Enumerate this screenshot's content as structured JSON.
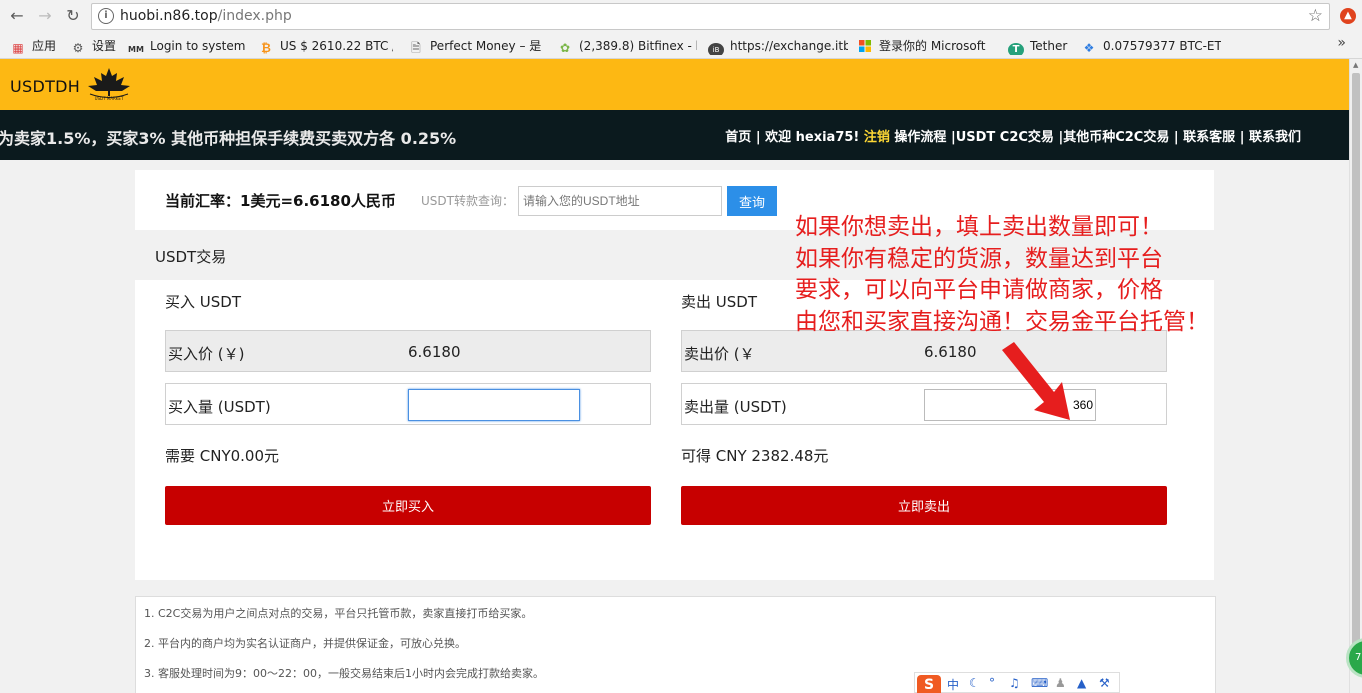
{
  "browser": {
    "url_host": "huobi.n86.top",
    "url_path": "/index.php",
    "bookmarks": [
      {
        "label": "应用",
        "icon": "apps-grid-icon"
      },
      {
        "label": "设置",
        "icon": "gear-icon"
      },
      {
        "label": "Login to system",
        "icon": "mm-logo-icon"
      },
      {
        "label": "US $ 2610.22 BTC /",
        "icon": "bitcoin-icon"
      },
      {
        "label": "Perfect Money – 是",
        "icon": "page-icon"
      },
      {
        "label": "(2,389.8) Bitfinex - b",
        "icon": "bitfinex-leaf-icon"
      },
      {
        "label": "https://exchange.itb",
        "icon": "ib-icon"
      },
      {
        "label": "登录你的 Microsoft",
        "icon": "microsoft-icon"
      },
      {
        "label": "Tether",
        "icon": "tether-icon"
      },
      {
        "label": "0.07579377 BTC-ET",
        "icon": "diamond-icon"
      }
    ],
    "more": "»"
  },
  "header": {
    "logo_text": "USDTDH",
    "logo_badge": "USDT MARKET"
  },
  "navbar": {
    "marquee": "为卖家1.5%，买家3% 其他币种担保手续费买卖双方各 0.25%",
    "home": "首页",
    "sep1": " | ",
    "welcome": "欢迎 hexia75! ",
    "logout": "注销",
    "process": " 操作流程 ",
    "c2c": "|USDT C2C交易",
    "other": " |其他币种C2C交易",
    "sep2": " | ",
    "service": "联系客服",
    "sep3": " | ",
    "contact": "联系我们"
  },
  "rate_bar": {
    "rate": "当前汇率：1美元=6.6180人民币",
    "query_label": "USDT转款查询：",
    "query_placeholder": "请输入您的USDT地址",
    "query_button": "查询"
  },
  "section_title": "USDT交易",
  "buy": {
    "heading": "买入 USDT",
    "price_label": "买入价 (￥)",
    "price_value": "6.6180",
    "qty_label": "买入量 (USDT)",
    "qty_value": "",
    "total": "需要 CNY0.00元",
    "button": "立即买入"
  },
  "sell": {
    "heading": "卖出 USDT",
    "price_label": "卖出价 (￥",
    "price_value": "6.6180",
    "qty_label": "卖出量 (USDT)",
    "qty_value": "360",
    "total": "可得 CNY 2382.48元",
    "button": "立即卖出"
  },
  "annotation": {
    "line1": "如果你想卖出，填上卖出数量即可！",
    "line2": "如果你有稳定的货源，数量达到平台",
    "line3": "要求，可以向平台申请做商家，价格",
    "line4": "由您和买家直接沟通！交易金平台托管！",
    "color": "#e61e1e"
  },
  "notes": [
    "1. C2C交易为用户之间点对点的交易，平台只托管币款，卖家直接打币给买家。",
    "2. 平台内的商户均为实名认证商户，并提供保证金，可放心兑换。",
    "3. 客服处理时间为9：00～22：00，一般交易结束后1小时内会完成打款给卖家。"
  ],
  "ime": {
    "logo": "S",
    "lang": "中"
  },
  "colors": {
    "header_yellow": "#fdb813",
    "navbar_dark": "#0b1a1e",
    "action_red": "#c70000",
    "query_blue": "#2c8fe8"
  }
}
